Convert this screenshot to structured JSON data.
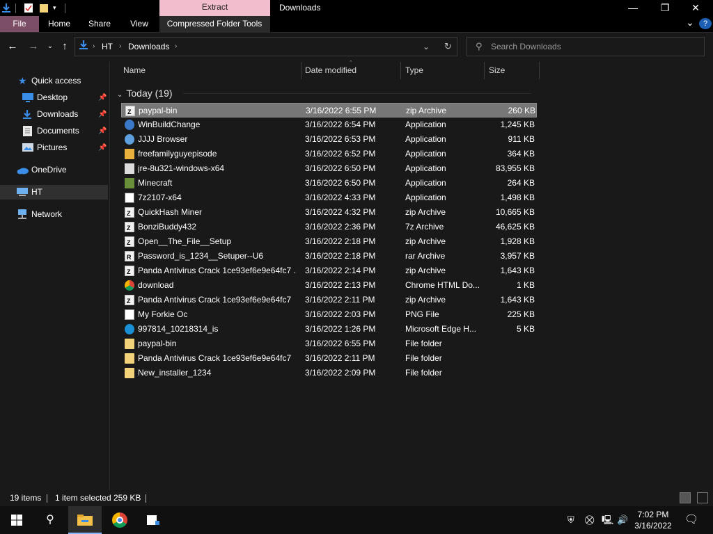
{
  "window": {
    "title": "Downloads",
    "context_tab_group": "Extract",
    "minimize": "—",
    "maximize": "❐",
    "close": "✕"
  },
  "ribbon": {
    "tabs": [
      "File",
      "Home",
      "Share",
      "View",
      "Compressed Folder Tools"
    ],
    "expand": "⌄",
    "help": "?"
  },
  "address": {
    "crumbs": [
      "HT",
      "Downloads"
    ],
    "search_placeholder": "Search Downloads"
  },
  "sidebar": {
    "items": [
      {
        "label": "Quick access",
        "icon": "star-icon"
      },
      {
        "label": "Desktop",
        "icon": "desktop-icon",
        "pinned": true
      },
      {
        "label": "Downloads",
        "icon": "download-icon",
        "pinned": true
      },
      {
        "label": "Documents",
        "icon": "documents-icon",
        "pinned": true
      },
      {
        "label": "Pictures",
        "icon": "pictures-icon",
        "pinned": true
      },
      {
        "label": "OneDrive",
        "icon": "cloud-icon"
      },
      {
        "label": "HT",
        "icon": "computer-icon"
      },
      {
        "label": "Network",
        "icon": "network-icon"
      }
    ]
  },
  "columns": {
    "name": "Name",
    "date": "Date modified",
    "type": "Type",
    "size": "Size"
  },
  "group": {
    "label": "Today (19)"
  },
  "files": [
    {
      "name": "paypal-bin",
      "date": "3/16/2022 6:55 PM",
      "type": "zip Archive",
      "size": "260 KB",
      "icon": "zip"
    },
    {
      "name": "WinBuildChange",
      "date": "3/16/2022 6:54 PM",
      "type": "Application",
      "size": "1,245 KB",
      "icon": "app"
    },
    {
      "name": "JJJJ Browser",
      "date": "3/16/2022 6:53 PM",
      "type": "Application",
      "size": "911 KB",
      "icon": "fox"
    },
    {
      "name": "freefamilyguyepisode",
      "date": "3/16/2022 6:52 PM",
      "type": "Application",
      "size": "364 KB",
      "icon": "dog"
    },
    {
      "name": "jre-8u321-windows-x64",
      "date": "3/16/2022 6:50 PM",
      "type": "Application",
      "size": "83,955 KB",
      "icon": "java"
    },
    {
      "name": "Minecraft",
      "date": "3/16/2022 6:50 PM",
      "type": "Application",
      "size": "264 KB",
      "icon": "mc"
    },
    {
      "name": "7z2107-x64",
      "date": "3/16/2022 4:33 PM",
      "type": "Application",
      "size": "1,498 KB",
      "icon": "sz"
    },
    {
      "name": "QuickHash Miner",
      "date": "3/16/2022 4:32 PM",
      "type": "zip Archive",
      "size": "10,665 KB",
      "icon": "zip"
    },
    {
      "name": "BonziBuddy432",
      "date": "3/16/2022 2:36 PM",
      "type": "7z Archive",
      "size": "46,625 KB",
      "icon": "zip"
    },
    {
      "name": "Open__The_File__Setup",
      "date": "3/16/2022 2:18 PM",
      "type": "zip Archive",
      "size": "1,928 KB",
      "icon": "zip"
    },
    {
      "name": "Password_is_1234__Setuper--U6",
      "date": "3/16/2022 2:18 PM",
      "type": "rar Archive",
      "size": "3,957 KB",
      "icon": "rar"
    },
    {
      "name": "Panda Antivirus Crack 1ce93ef6e9e64fc7 ...",
      "date": "3/16/2022 2:14 PM",
      "type": "zip Archive",
      "size": "1,643 KB",
      "icon": "zip"
    },
    {
      "name": "download",
      "date": "3/16/2022 2:13 PM",
      "type": "Chrome HTML Do...",
      "size": "1 KB",
      "icon": "chrome"
    },
    {
      "name": "Panda Antivirus Crack 1ce93ef6e9e64fc7",
      "date": "3/16/2022 2:11 PM",
      "type": "zip Archive",
      "size": "1,643 KB",
      "icon": "zip"
    },
    {
      "name": "My Forkie Oc",
      "date": "3/16/2022 2:03 PM",
      "type": "PNG File",
      "size": "225 KB",
      "icon": "png"
    },
    {
      "name": "997814_10218314_is",
      "date": "3/16/2022 1:26 PM",
      "type": "Microsoft Edge H...",
      "size": "5 KB",
      "icon": "edge"
    },
    {
      "name": "paypal-bin",
      "date": "3/16/2022 6:55 PM",
      "type": "File folder",
      "size": "",
      "icon": "folder"
    },
    {
      "name": "Panda Antivirus Crack 1ce93ef6e9e64fc7",
      "date": "3/16/2022 2:11 PM",
      "type": "File folder",
      "size": "",
      "icon": "folder"
    },
    {
      "name": "New_installer_1234",
      "date": "3/16/2022 2:09 PM",
      "type": "File folder",
      "size": "",
      "icon": "folder"
    }
  ],
  "status": {
    "items_count": "19 items",
    "selection": "1 item selected",
    "selection_size": "259 KB"
  },
  "taskbar": {
    "time": "7:02 PM",
    "date": "3/16/2022"
  }
}
